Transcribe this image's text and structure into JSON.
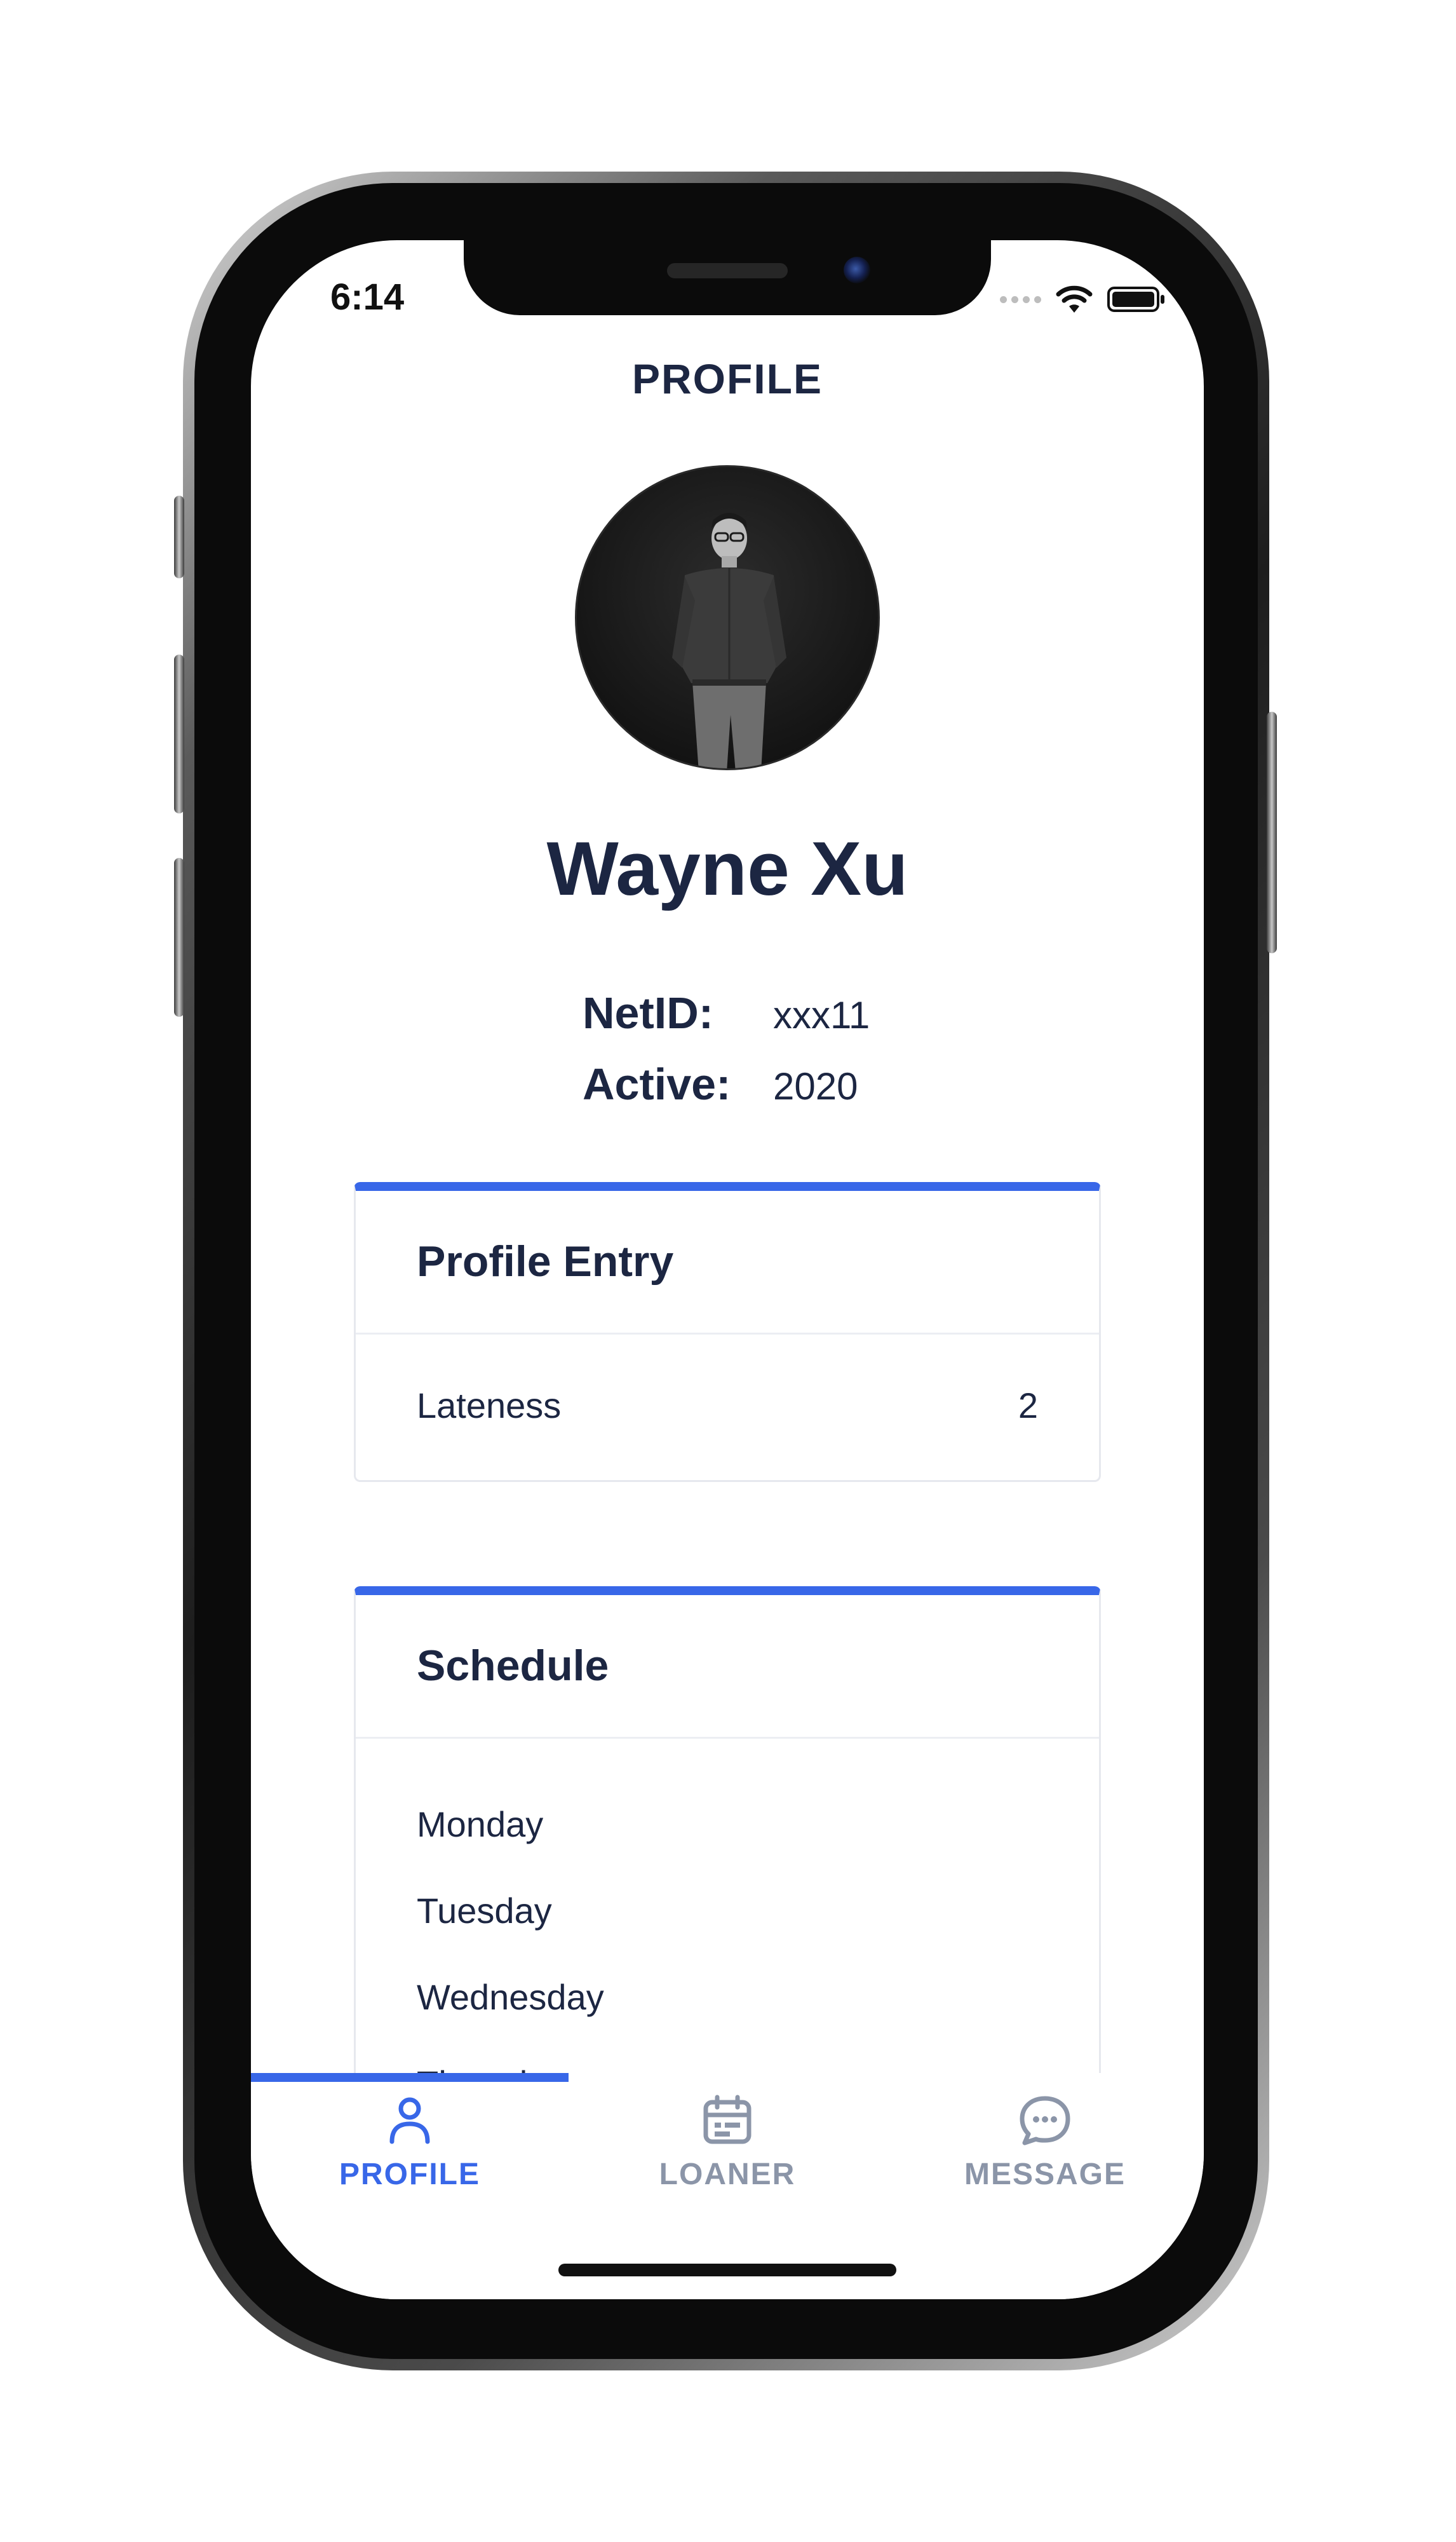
{
  "status_bar": {
    "time": "6:14"
  },
  "header": {
    "title": "PROFILE"
  },
  "profile": {
    "name": "Wayne Xu",
    "fields": [
      {
        "label": "NetID:",
        "value": "xxx11"
      },
      {
        "label": "Active:",
        "value": "2020"
      }
    ]
  },
  "profile_entry": {
    "title": "Profile Entry",
    "rows": [
      {
        "label": "Lateness",
        "value": "2"
      }
    ]
  },
  "schedule": {
    "title": "Schedule",
    "days": [
      "Monday",
      "Tuesday",
      "Wednesday",
      "Thursday"
    ]
  },
  "tabbar": {
    "tabs": [
      {
        "label": "PROFILE",
        "icon": "person-icon",
        "active": true
      },
      {
        "label": "LOANER",
        "icon": "calendar-icon",
        "active": false
      },
      {
        "label": "MESSAGE",
        "icon": "chat-bubble-icon",
        "active": false
      }
    ]
  },
  "colors": {
    "accent": "#3867e8",
    "text_dark": "#1c2642",
    "tab_inactive": "#8b95a8"
  }
}
